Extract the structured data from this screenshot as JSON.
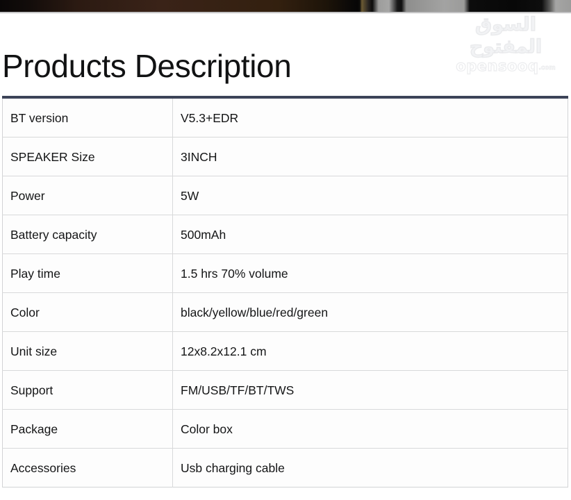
{
  "photo_strip": {
    "description": "cropped-dark-product-photo-edge"
  },
  "watermark": {
    "arabic_text": "السوق المفتوح",
    "latin_text": "opensooq",
    "tld_text": ".com"
  },
  "page_title": "Products Description",
  "spec_table": {
    "rows": [
      {
        "label": "BT version",
        "value": "V5.3+EDR"
      },
      {
        "label": "SPEAKER Size",
        "value": "3INCH"
      },
      {
        "label": "Power",
        "value": "5W"
      },
      {
        "label": "Battery capacity",
        "value": "500mAh"
      },
      {
        "label": "Play time",
        "value": "1.5 hrs 70% volume"
      },
      {
        "label": "Color",
        "value": "black/yellow/blue/red/green"
      },
      {
        "label": "Unit size",
        "value": "12x8.2x12.1 cm"
      },
      {
        "label": "Support",
        "value": "FM/USB/TF/BT/TWS"
      },
      {
        "label": "Package",
        "value": "Color box"
      },
      {
        "label": "Accessories",
        "value": "Usb charging cable"
      }
    ]
  },
  "colors": {
    "table_top_border": "#3c4458",
    "table_grid_line": "#d8d9da",
    "text": "#141516",
    "cell_background": "#fdfdfd",
    "watermark": "#e9eaec"
  }
}
